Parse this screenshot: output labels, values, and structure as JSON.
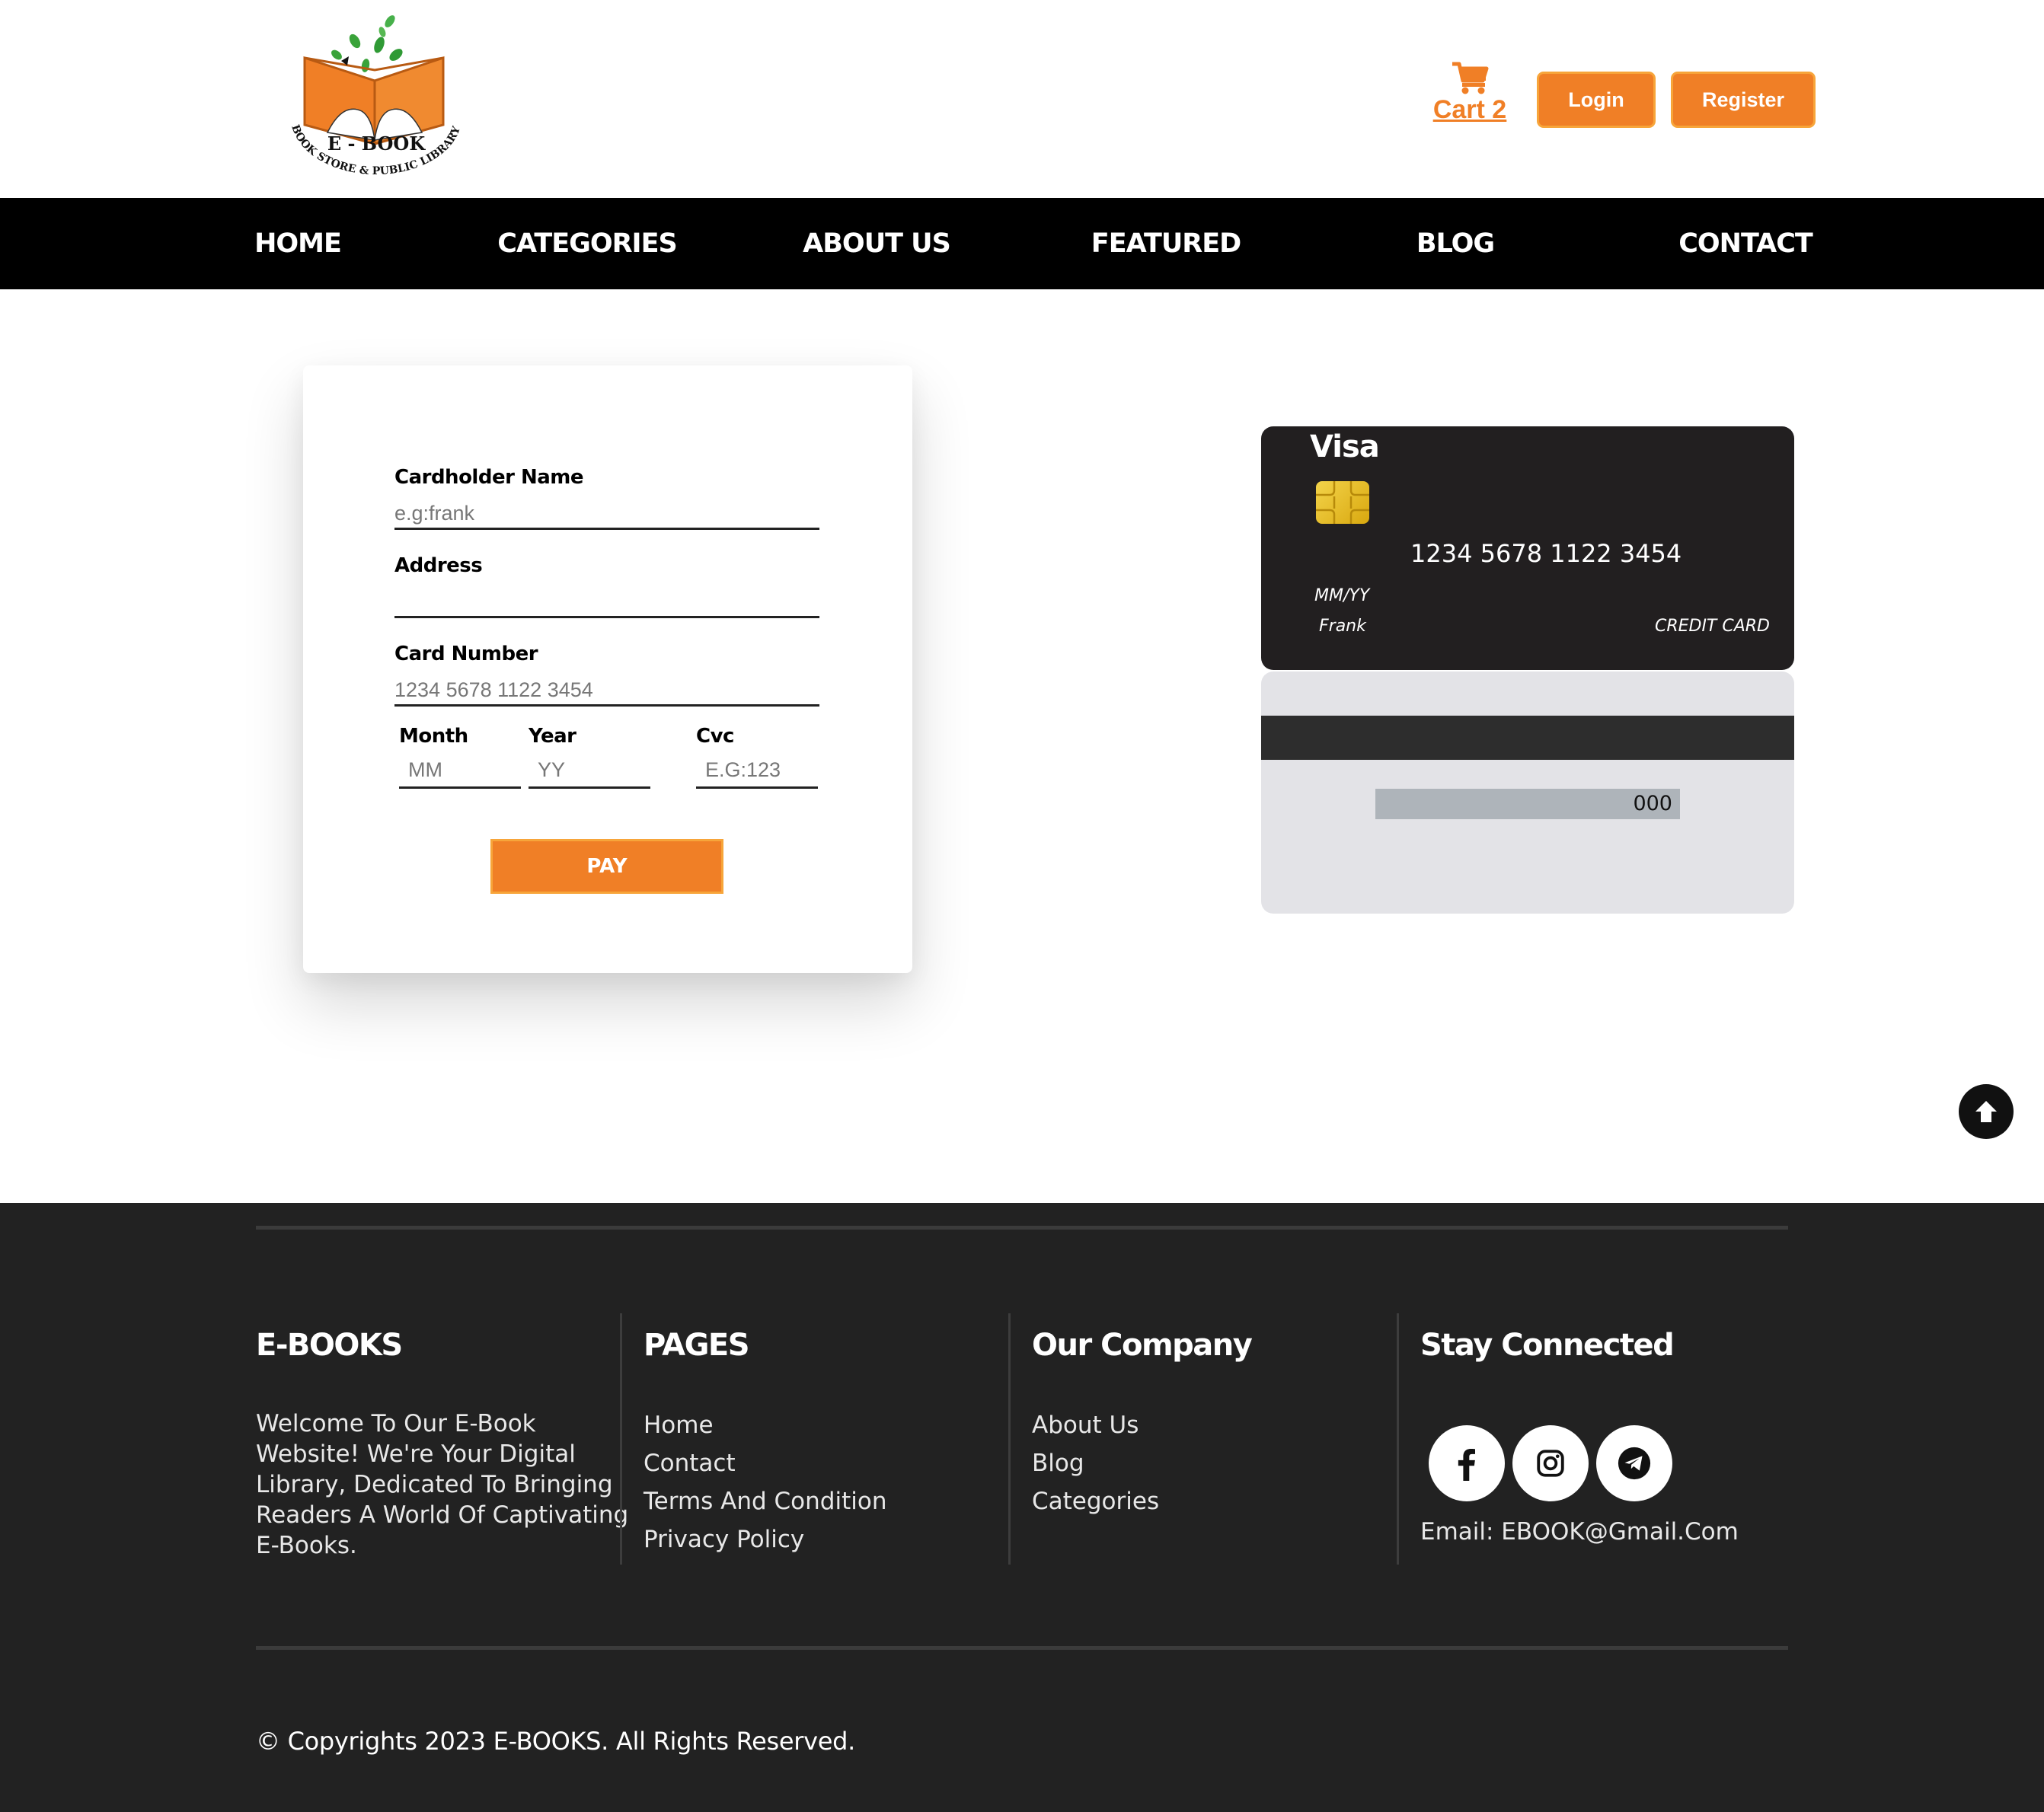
{
  "header": {
    "logo": {
      "title": "E - BOOK",
      "subtitle": "BOOK STORE & PUBLIC LIBRARY"
    },
    "cart_label": "Cart 2",
    "login_label": "Login",
    "register_label": "Register"
  },
  "nav": {
    "items": [
      {
        "label": "HOME"
      },
      {
        "label": "CATEGORIES"
      },
      {
        "label": "ABOUT US"
      },
      {
        "label": "FEATURED"
      },
      {
        "label": "BLOG"
      },
      {
        "label": "CONTACT"
      }
    ]
  },
  "form": {
    "cardholder": {
      "label": "Cardholder Name",
      "placeholder": "e.g:frank",
      "value": ""
    },
    "address": {
      "label": "Address",
      "placeholder": "",
      "value": ""
    },
    "card_number": {
      "label": "Card Number",
      "placeholder": "1234 5678 1122 3454",
      "value": ""
    },
    "month": {
      "label": "Month",
      "placeholder": "MM"
    },
    "year": {
      "label": "Year",
      "placeholder": "YY"
    },
    "cvc": {
      "label": "Cvc",
      "placeholder": "E.G:123"
    },
    "pay_label": "PAY"
  },
  "card_preview": {
    "brand": "Visa",
    "number": "1234 5678 1122 3454",
    "expiry": "MM/YY",
    "name": "Frank",
    "type": "CREDIT CARD",
    "cvc": "000"
  },
  "footer": {
    "brand": {
      "title": "E-BOOKS",
      "description_lines": [
        "Welcome To Our E-Book",
        "Website! We're Your Digital",
        "Library, Dedicated To Bringing",
        "Readers A World Of Captivating",
        "E-Books."
      ]
    },
    "pages": {
      "title": "PAGES",
      "links": [
        "Home",
        "Contact",
        "Terms And Condition",
        "Privacy Policy"
      ]
    },
    "company": {
      "title": "Our Company",
      "links": [
        "About Us",
        "Blog",
        "Categories"
      ]
    },
    "connect": {
      "title": "Stay Connected",
      "socials": [
        "facebook-icon",
        "instagram-icon",
        "telegram-icon"
      ],
      "email": "Email: EBOOK@Gmail.Com"
    },
    "copyright": "© Copyrights 2023 E-BOOKS. All Rights Reserved."
  },
  "colors": {
    "accent": "#f07f26",
    "nav_bg": "#000000",
    "footer_bg": "#222222",
    "card_front": "#221f20",
    "card_back": "#e3e3e7"
  }
}
